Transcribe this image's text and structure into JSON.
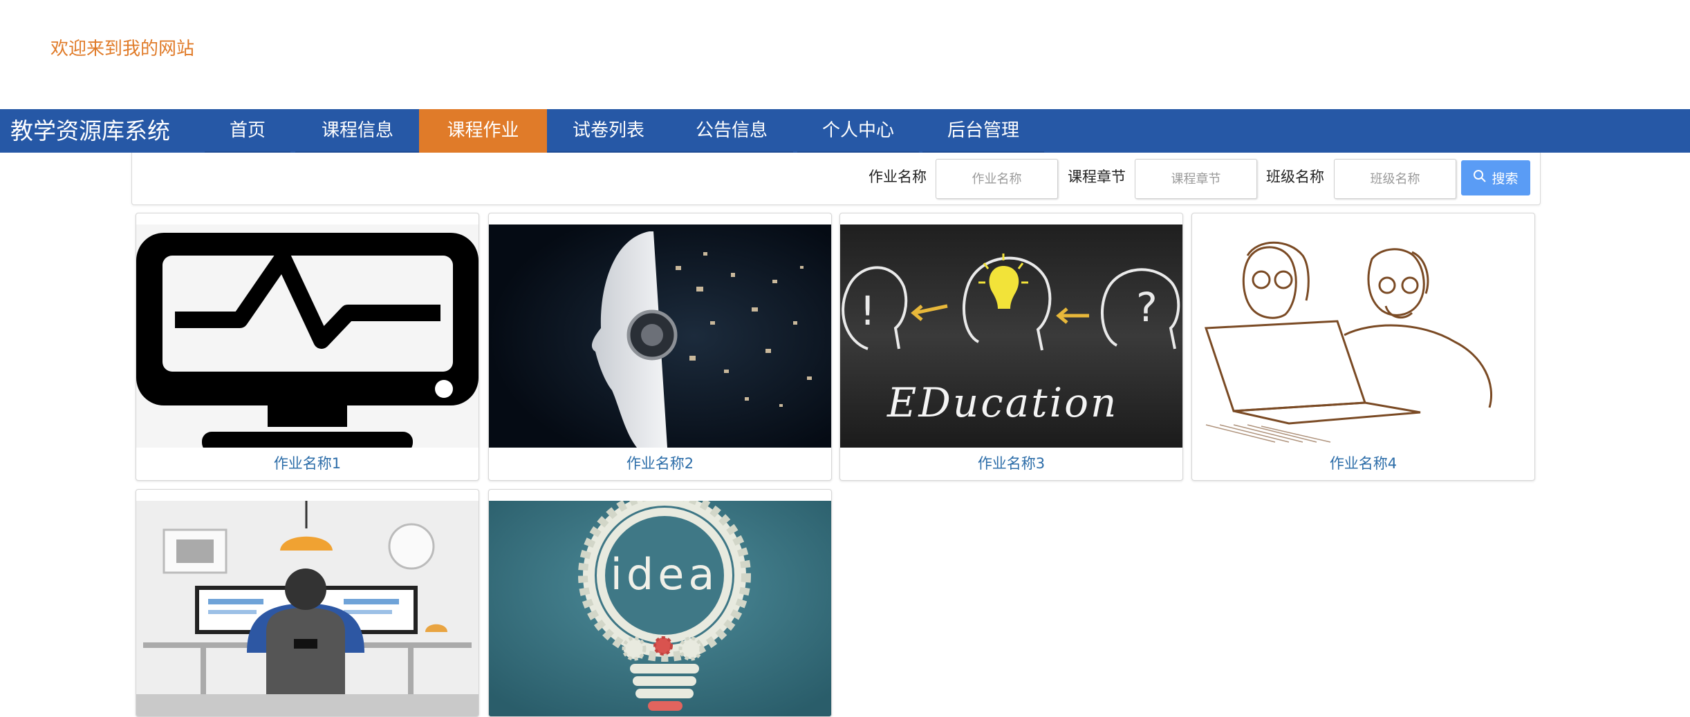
{
  "header": {
    "welcome_text": "欢迎来到我的网站"
  },
  "navbar": {
    "brand": "教学资源库系统",
    "items": [
      {
        "label": "首页"
      },
      {
        "label": "课程信息"
      },
      {
        "label": "课程作业",
        "active": true
      },
      {
        "label": "试卷列表"
      },
      {
        "label": "公告信息"
      },
      {
        "label": "个人中心"
      },
      {
        "label": "后台管理"
      }
    ],
    "colors": {
      "background": "#2658a6",
      "active": "#e07b29"
    }
  },
  "search": {
    "fields": [
      {
        "label": "作业名称",
        "placeholder": "作业名称"
      },
      {
        "label": "课程章节",
        "placeholder": "课程章节"
      },
      {
        "label": "班级名称",
        "placeholder": "班级名称"
      }
    ],
    "button_label": "搜索",
    "button_icon": "search-icon"
  },
  "cards": [
    {
      "title": "作业名称1",
      "image": "monitor-heartbeat-icon"
    },
    {
      "title": "作业名称2",
      "image": "ai-robot-head-image"
    },
    {
      "title": "作业名称3",
      "image": "education-chalkboard-image"
    },
    {
      "title": "作业名称4",
      "image": "people-laptop-sketch-image"
    },
    {
      "title": "",
      "image": "office-worker-desk-image"
    },
    {
      "title": "",
      "image": "idea-gear-bulb-image"
    }
  ]
}
